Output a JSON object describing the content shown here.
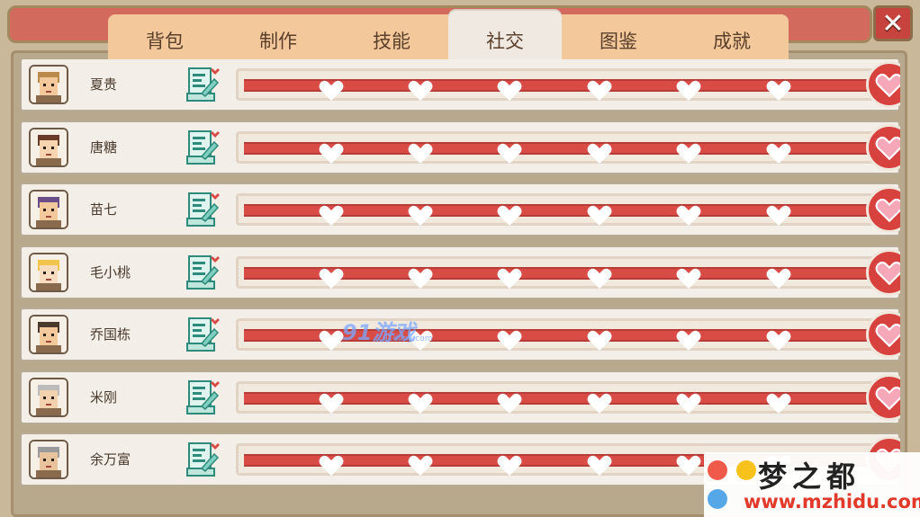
{
  "tabs": [
    "背包",
    "制作",
    "技能",
    "社交",
    "图鉴",
    "成就"
  ],
  "active_tab": "社交",
  "close_label": "✕",
  "npcs": [
    {
      "name": "夏贵",
      "hair": "#b98a4a",
      "face": "#f3c89b",
      "level": 1.0
    },
    {
      "name": "唐糖",
      "hair": "#6a3b26",
      "face": "#f6d4b0",
      "level": 1.0
    },
    {
      "name": "苗七",
      "hair": "#6b4d8a",
      "face": "#f3c89b",
      "level": 1.0
    },
    {
      "name": "毛小桃",
      "hair": "#f2c44a",
      "face": "#f7dcc0",
      "level": 1.0
    },
    {
      "name": "乔国栋",
      "hair": "#4a3a2d",
      "face": "#f3c89b",
      "level": 1.0
    },
    {
      "name": "米刚",
      "hair": "#bbbbbb",
      "face": "#f1d1ae",
      "level": 1.0
    },
    {
      "name": "余万富",
      "hair": "#9a9a9a",
      "face": "#e8c39c",
      "level": 1.0
    }
  ],
  "colors": {
    "bar": "#d94b45",
    "panel": "#b9a98c",
    "tab_bar": "#f3c89b"
  },
  "watermark": {
    "title": "梦之都",
    "url": "www.mzhidu.com",
    "site_mark": "91游戏",
    "site_sub": "91danji.com"
  }
}
